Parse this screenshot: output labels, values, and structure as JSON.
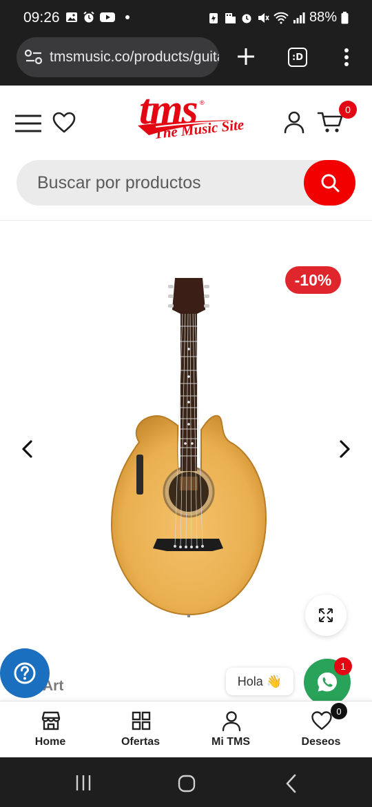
{
  "status_bar": {
    "time": "09:26",
    "battery": "88%"
  },
  "browser": {
    "url": "tmsmusic.co/products/guitarra",
    "tab_icon_text": ":D"
  },
  "header": {
    "logo_text": "tms",
    "logo_reg": "®",
    "logo_tagline": "The Music Site",
    "cart_count": "0",
    "search_placeholder": "Buscar por productos"
  },
  "product": {
    "discount": "-10%",
    "title_peek": "Art"
  },
  "floating": {
    "hola_text": "Hola 👋",
    "whatsapp_count": "1"
  },
  "bottom_nav": {
    "items": [
      {
        "label": "Home",
        "icon": "store-icon"
      },
      {
        "label": "Ofertas",
        "icon": "grid-icon"
      },
      {
        "label": "Mi TMS",
        "icon": "user-icon"
      },
      {
        "label": "Deseos",
        "icon": "heart-icon"
      }
    ],
    "wish_count": "0"
  },
  "colors": {
    "brand_red": "#e30613",
    "search_red": "#f20000",
    "help_blue": "#1b6fbf",
    "whatsapp_green": "#29a35a"
  }
}
